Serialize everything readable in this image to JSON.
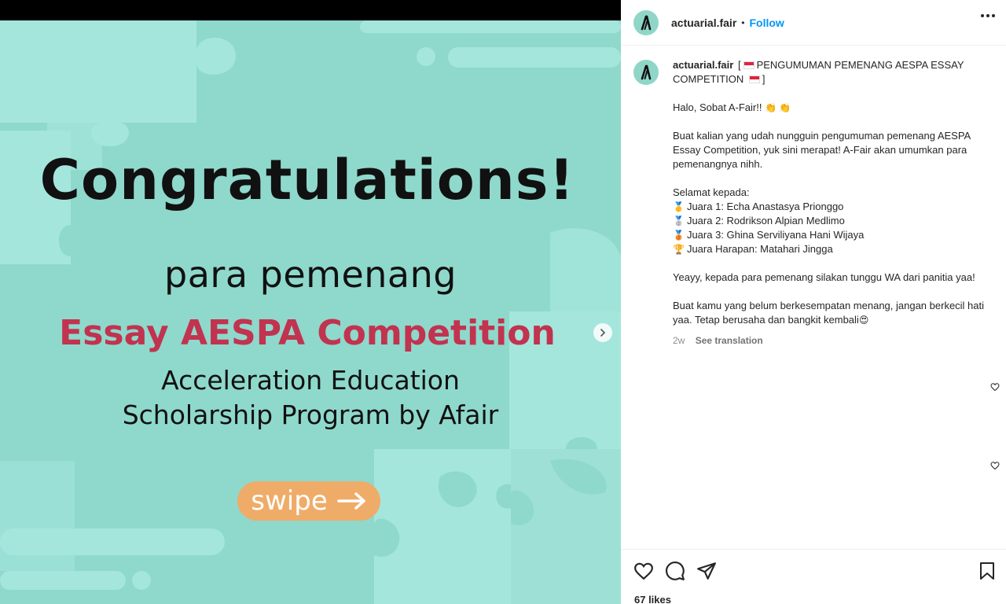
{
  "post": {
    "headline": "Congratulations!",
    "subheadline": "para pemenang",
    "competition": "Essay AESPA Competition",
    "program_line1": "Acceleration Education",
    "program_line2": "Scholarship Program by Afair",
    "swipe_label": "swipe"
  },
  "header": {
    "username": "actuarial.fair",
    "separator": "•",
    "follow_label": "Follow"
  },
  "caption": {
    "username": "actuarial.fair",
    "title_open": "[",
    "title_text": "PENGUMUMAN PEMENANG AESPA ESSAY COMPETITION",
    "title_close": "]",
    "greeting": "Halo, Sobat A-Fair!!",
    "intro": "Buat kalian yang udah nungguin pengumuman pemenang AESPA Essay Competition, yuk sini merapat! A-Fair akan umumkan para pemenangnya nihh.",
    "winners_heading": "Selamat kepada:",
    "winners": [
      {
        "emoji": "🥇",
        "text": "Juara 1: Echa Anastasya Prionggo"
      },
      {
        "emoji": "🥈",
        "text": "Juara 2: Rodrikson Alpian Medlimo"
      },
      {
        "emoji": "🥉",
        "text": "Juara 3: Ghina Serviliyana Hani Wijaya"
      },
      {
        "emoji": "🏆",
        "text": "Juara Harapan: Matahari Jingga"
      }
    ],
    "note1": "Yeayy, kepada para pemenang silakan tunggu WA dari panitia yaa!",
    "note2": "Buat kamu yang belum berkesempatan menang, jangan berkecil hati yaa. Tetap berusaha dan bangkit kembali",
    "note2_emoji": "😍",
    "time": "2w",
    "see_translation": "See translation"
  },
  "footer": {
    "likes": "67 likes"
  },
  "colors": {
    "follow_blue": "#0095f6",
    "competition_red": "#c1334f",
    "swipe_orange": "#efac68",
    "teal_bg": "#8fd8cc"
  }
}
